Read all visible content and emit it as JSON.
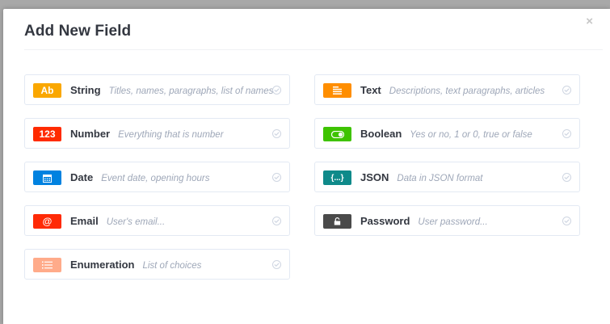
{
  "modal": {
    "title": "Add New Field",
    "close_label": "×"
  },
  "fields": [
    {
      "name": "String",
      "description": "Titles, names, paragraphs, list of names",
      "icon": "ab-text-icon",
      "badge_text": "Ab",
      "color": "#faa700"
    },
    {
      "name": "Text",
      "description": "Descriptions, text paragraphs, articles",
      "icon": "align-left-icon",
      "badge_text": "",
      "color": "#ff8e00"
    },
    {
      "name": "Number",
      "description": "Everything that is number",
      "icon": "number-icon",
      "badge_text": "123",
      "color": "#ff2b00"
    },
    {
      "name": "Boolean",
      "description": "Yes or no, 1 or 0, true or false",
      "icon": "toggle-icon",
      "badge_text": "",
      "color": "#3ec300"
    },
    {
      "name": "Date",
      "description": "Event date, opening hours",
      "icon": "calendar-icon",
      "badge_text": "",
      "color": "#0082e0"
    },
    {
      "name": "JSON",
      "description": "Data in JSON format",
      "icon": "braces-icon",
      "badge_text": "{...}",
      "color": "#0f8a8a"
    },
    {
      "name": "Email",
      "description": "User's email...",
      "icon": "at-icon",
      "badge_text": "@",
      "color": "#ff2a06"
    },
    {
      "name": "Password",
      "description": "User password...",
      "icon": "lock-icon",
      "badge_text": "",
      "color": "#4a4a4a"
    },
    {
      "name": "Enumeration",
      "description": "List of choices",
      "icon": "list-icon",
      "badge_text": "",
      "color": "#ffab8a"
    }
  ]
}
